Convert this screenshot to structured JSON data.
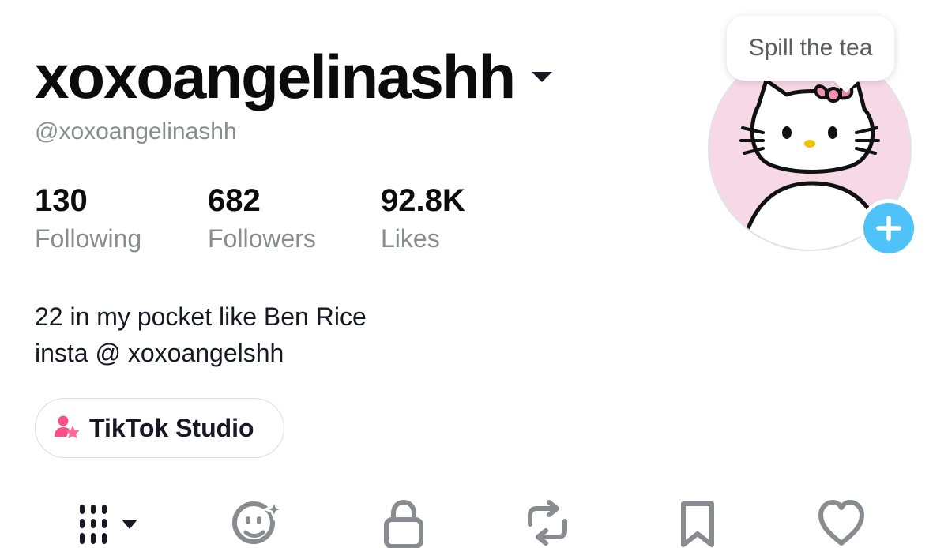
{
  "profile": {
    "display_name": "xoxoangelinashh",
    "handle": "@xoxoangelinashh",
    "stats": {
      "following": {
        "count": "130",
        "label": "Following"
      },
      "followers": {
        "count": "682",
        "label": "Followers"
      },
      "likes": {
        "count": "92.8K",
        "label": "Likes"
      }
    },
    "bio": {
      "line1": "22 in my pocket like Ben Rice",
      "line2": "insta @ xoxoangelshh"
    },
    "studio_button_label": "TikTok Studio",
    "tooltip": "Spill the tea"
  },
  "tabs": [
    {
      "icon": "grid-icon"
    },
    {
      "icon": "sparkle-face-icon"
    },
    {
      "icon": "lock-icon"
    },
    {
      "icon": "repost-icon"
    },
    {
      "icon": "bookmark-icon"
    },
    {
      "icon": "heart-icon"
    }
  ],
  "colors": {
    "accent_blue": "#4fc3f7",
    "avatar_pink": "#f6d8e6",
    "bow_pink": "#f08fb0",
    "studio_icon_pink": "#ff4f87",
    "muted_text": "#8a8b91"
  }
}
